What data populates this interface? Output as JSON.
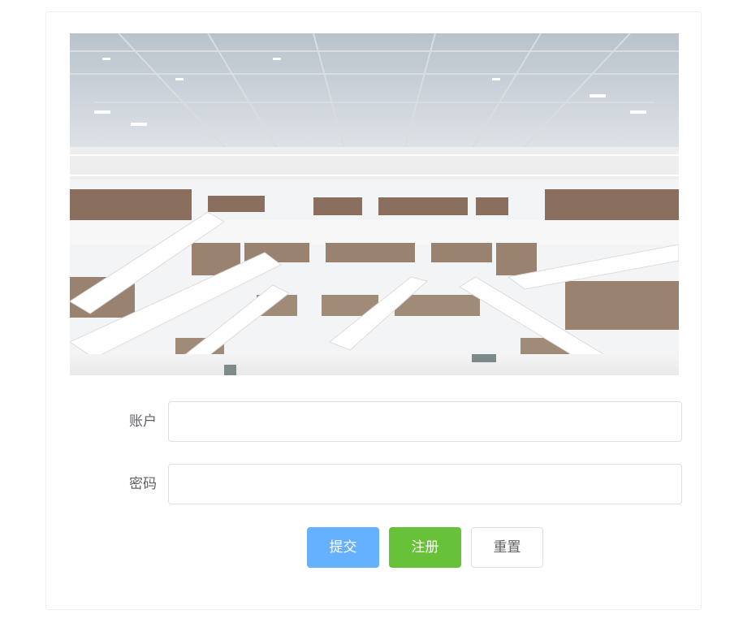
{
  "hero": {
    "description": "library-interior-photo"
  },
  "form": {
    "account_label": "账户",
    "account_value": "",
    "account_placeholder": "",
    "password_label": "密码",
    "password_value": "",
    "password_placeholder": ""
  },
  "buttons": {
    "submit_label": "提交",
    "register_label": "注册",
    "reset_label": "重置"
  },
  "colors": {
    "primary": "#66b1ff",
    "success": "#67c23a",
    "border": "#dcdfe6",
    "text": "#606266"
  }
}
